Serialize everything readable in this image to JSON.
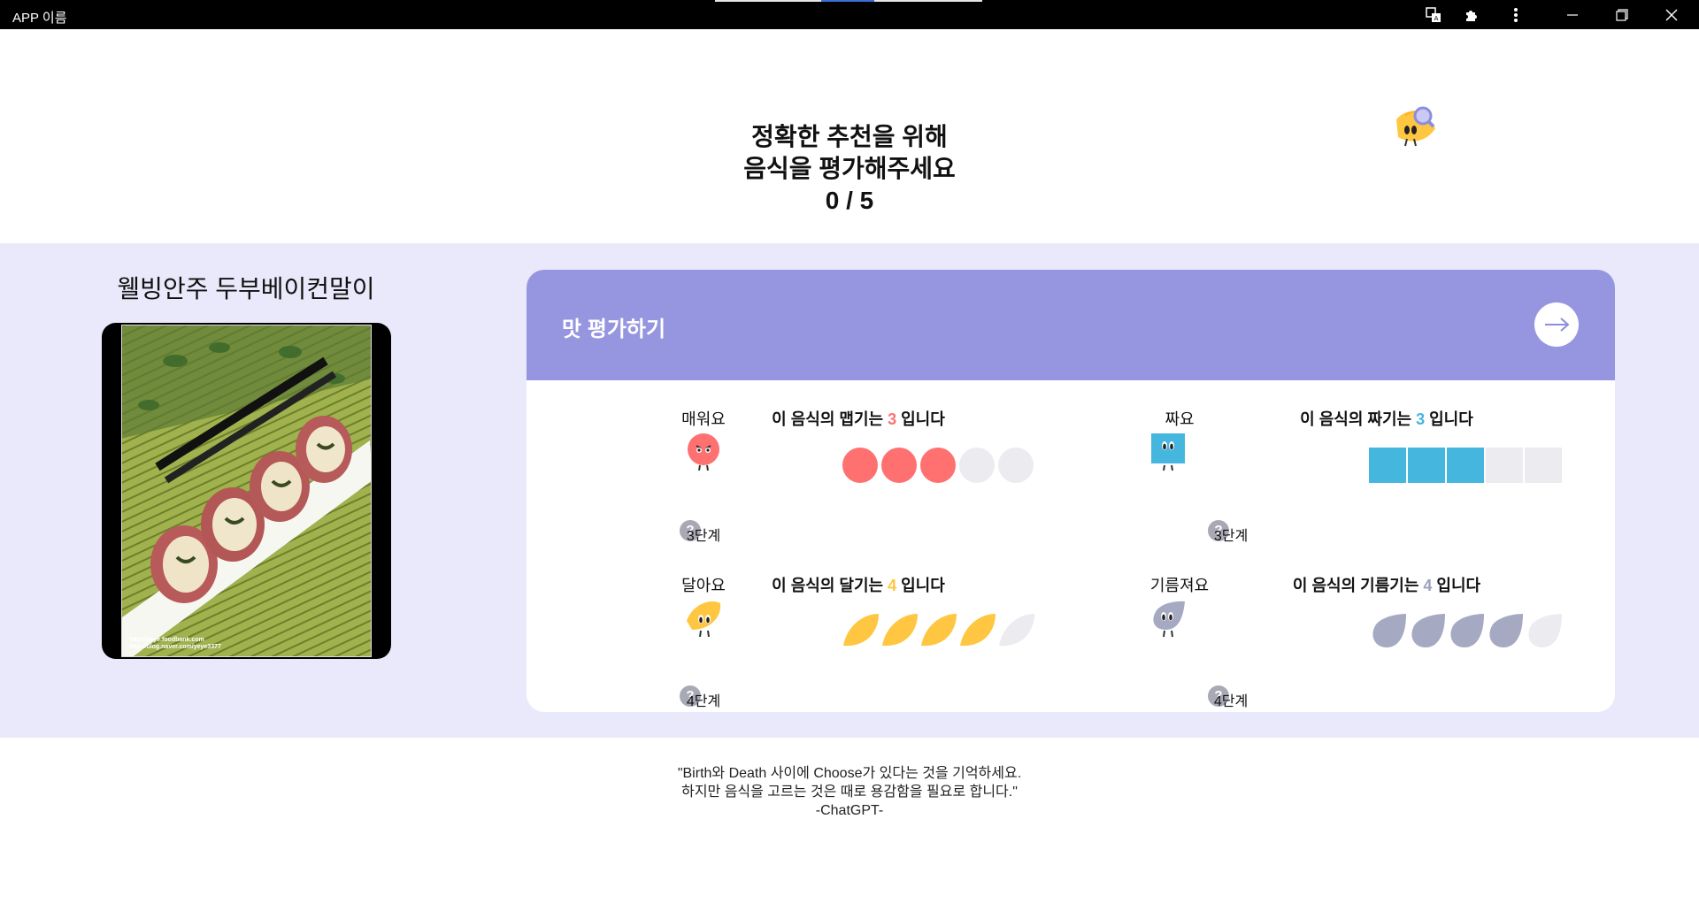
{
  "window": {
    "title": "APP 이름",
    "icons": [
      "translate-icon",
      "extension-icon",
      "more-vert-icon",
      "minimize-icon",
      "maximize-icon",
      "close-icon"
    ]
  },
  "header": {
    "line1": "정확한 추천을 위해",
    "line2": "음식을 평가해주세요",
    "progress": "0 / 5"
  },
  "food": {
    "name": "웰빙안주 두부베이컨말이",
    "caption_line1": "http://yaye.foodbank.com",
    "caption_line2": "http://blog.naver.com/yeye3377"
  },
  "panel": {
    "title": "맛 평가하기"
  },
  "ratings": [
    {
      "key": "spicy",
      "label": "매워요",
      "level_text": "3단계",
      "sentence_pre": "이 음식의 맵기는 ",
      "value_text": "3",
      "sentence_post": " 입니다",
      "value": 3,
      "max": 5,
      "color": "#ff7070",
      "shape": "circle"
    },
    {
      "key": "salty",
      "label": "짜요",
      "level_text": "3단계",
      "sentence_pre": "이 음식의 짜기는 ",
      "value_text": "3",
      "sentence_post": " 입니다",
      "value": 3,
      "max": 5,
      "color": "#45b6de",
      "shape": "square"
    },
    {
      "key": "sweet",
      "label": "달아요",
      "level_text": "4단계",
      "sentence_pre": "이 음식의 달기는 ",
      "value_text": "4",
      "sentence_post": " 입니다",
      "value": 4,
      "max": 5,
      "color": "#ffc641",
      "shape": "lemon"
    },
    {
      "key": "greasy",
      "label": "기름져요",
      "level_text": "4단계",
      "sentence_pre": "이 음식의 기름기는 ",
      "value_text": "4",
      "sentence_post": " 입니다",
      "value": 4,
      "max": 5,
      "color": "#a5a9c2",
      "shape": "drop"
    }
  ],
  "inactive_color": "#ebebf0",
  "help_symbol": "?",
  "quote": {
    "line1": "\"Birth와 Death 사이에 Choose가 있다는 것을 기억하세요.",
    "line2": "하지만 음식을 고르는 것은 때로 용감함을 필요로 합니다.\"",
    "line3": "-ChatGPT-"
  }
}
